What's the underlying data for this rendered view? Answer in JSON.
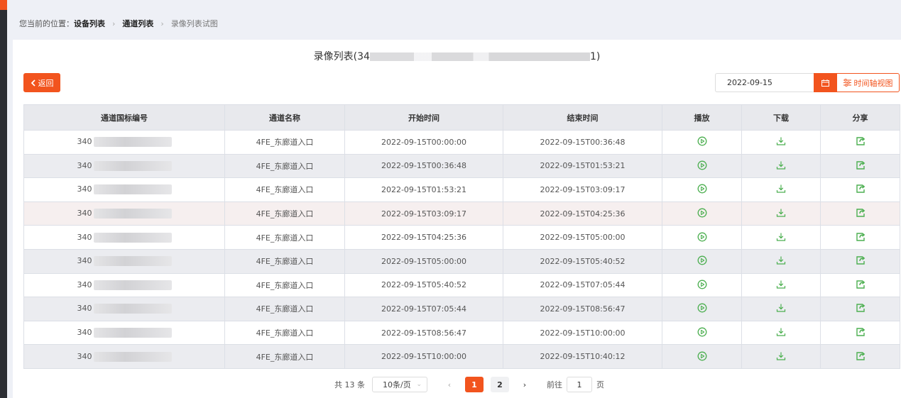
{
  "breadcrumb": {
    "prefix": "您当前的位置：",
    "item1": "设备列表",
    "item2": "通道列表",
    "item3": "录像列表试图"
  },
  "title": {
    "before": "录像列表(34",
    "after": "1)"
  },
  "back_button": "返回",
  "date_value": "2022-09-15",
  "timeline_button": "时间轴视图",
  "columns": [
    "通道国标编号",
    "通道名称",
    "开始时间",
    "结束时间",
    "播放",
    "下载",
    "分享"
  ],
  "rows": [
    {
      "id_prefix": "340",
      "name": "4FE_东廊道入口",
      "start": "2022-09-15T00:00:00",
      "end": "2022-09-15T00:36:48"
    },
    {
      "id_prefix": "340",
      "name": "4FE_东廊道入口",
      "start": "2022-09-15T00:36:48",
      "end": "2022-09-15T01:53:21"
    },
    {
      "id_prefix": "340",
      "name": "4FE_东廊道入口",
      "start": "2022-09-15T01:53:21",
      "end": "2022-09-15T03:09:17"
    },
    {
      "id_prefix": "340",
      "name": "4FE_东廊道入口",
      "start": "2022-09-15T03:09:17",
      "end": "2022-09-15T04:25:36"
    },
    {
      "id_prefix": "340",
      "name": "4FE_东廊道入口",
      "start": "2022-09-15T04:25:36",
      "end": "2022-09-15T05:00:00"
    },
    {
      "id_prefix": "340",
      "name": "4FE_东廊道入口",
      "start": "2022-09-15T05:00:00",
      "end": "2022-09-15T05:40:52"
    },
    {
      "id_prefix": "340",
      "name": "4FE_东廊道入口",
      "start": "2022-09-15T05:40:52",
      "end": "2022-09-15T07:05:44"
    },
    {
      "id_prefix": "340",
      "name": "4FE_东廊道入口",
      "start": "2022-09-15T07:05:44",
      "end": "2022-09-15T08:56:47"
    },
    {
      "id_prefix": "340",
      "name": "4FE_东廊道入口",
      "start": "2022-09-15T08:56:47",
      "end": "2022-09-15T10:00:00"
    },
    {
      "id_prefix": "340",
      "name": "4FE_东廊道入口",
      "start": "2022-09-15T10:00:00",
      "end": "2022-09-15T10:40:12"
    }
  ],
  "pagination": {
    "total": "共 13 条",
    "page_size": "10条/页",
    "pages": [
      "1",
      "2"
    ],
    "current_page": "1",
    "goto_label": "前往",
    "goto_value": "1",
    "goto_suffix": "页"
  },
  "colors": {
    "accent": "#f2541e",
    "action_icon": "#4caf50"
  },
  "icons": {
    "back": "chevron-left-icon",
    "calendar": "calendar-icon",
    "timeline": "timeline-icon",
    "play": "play-circle-icon",
    "download": "download-icon",
    "share": "share-icon"
  }
}
